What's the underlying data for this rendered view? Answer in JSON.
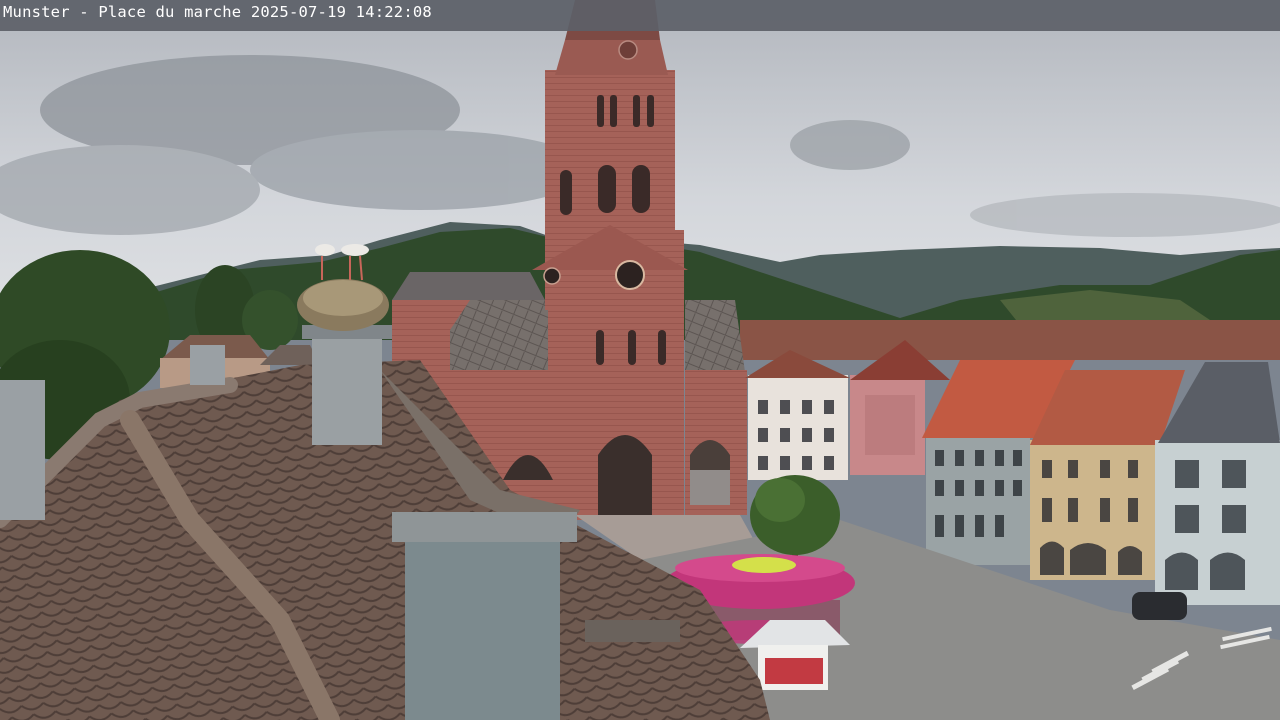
{
  "webcam": {
    "caption": "Munster - Place du marche 2025-07-19 14:22:08"
  },
  "colors": {
    "sky": "#c9ccd2",
    "cloud_dark": "#8e939a",
    "mountain_far": "#4a5a5c",
    "forest": "#2e4a2a",
    "church_sandstone": "#a8655c",
    "church_dark": "#7e4540",
    "roof_slate": "#6e6c6c",
    "roof_tile_red": "#c25a42",
    "umbrella_magenta": "#c2367a",
    "umbrella_top": "#d4e04a",
    "tiled_roof_foreground": "#7a6358",
    "square_pavement": "#8a8a88"
  }
}
